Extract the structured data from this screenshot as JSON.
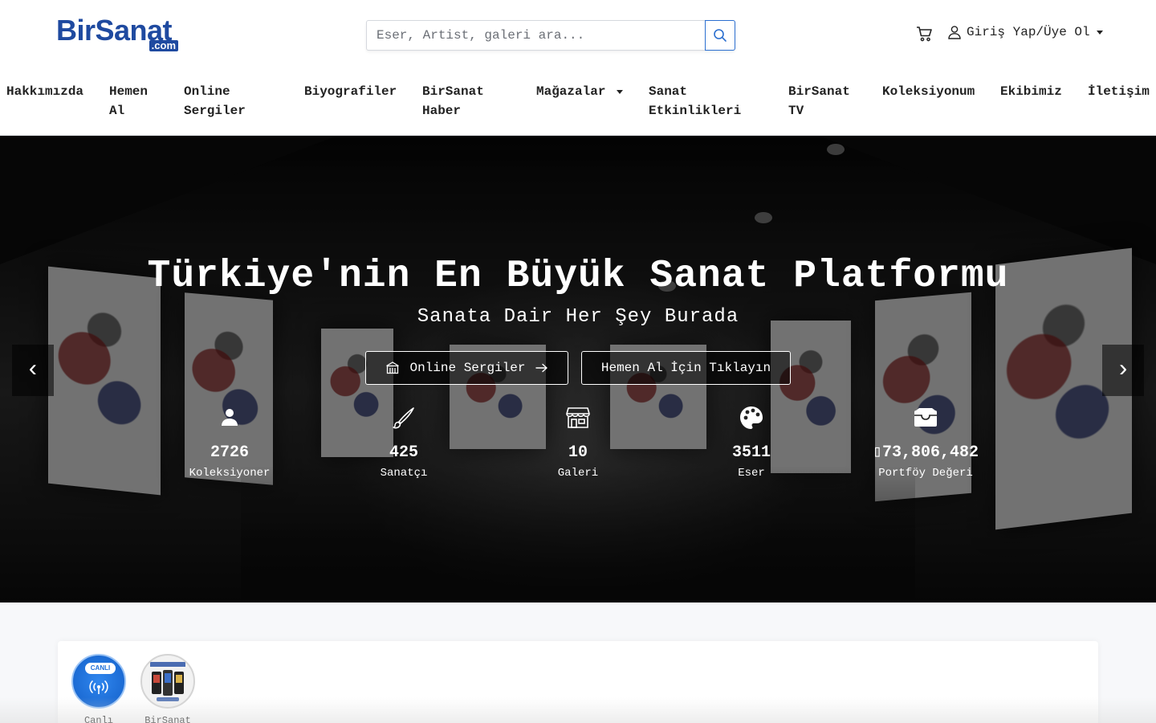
{
  "header": {
    "logo_brand": "BirSanat",
    "logo_tld": ".com",
    "search_placeholder": "Eser, Artist, galeri ara...",
    "login_label": "Giriş Yap/Üye Ol"
  },
  "nav": {
    "items": [
      {
        "label_1": "Hakkımızda",
        "label_2": ""
      },
      {
        "label_1": "Hemen",
        "label_2": "Al"
      },
      {
        "label_1": "Online",
        "label_2": "Sergiler"
      },
      {
        "label_1": "Biyografiler",
        "label_2": ""
      },
      {
        "label_1": "BirSanat",
        "label_2": "Haber"
      },
      {
        "label_1": "Mağazalar",
        "label_2": ""
      },
      {
        "label_1": "Sanat",
        "label_2": "Etkinlikleri"
      },
      {
        "label_1": "BirSanat",
        "label_2": "TV"
      },
      {
        "label_1": "Koleksiyonum",
        "label_2": ""
      },
      {
        "label_1": "Ekibimiz",
        "label_2": ""
      },
      {
        "label_1": "İletişim",
        "label_2": ""
      }
    ]
  },
  "hero": {
    "title": "Türkiye'nin En Büyük Sanat Platformu",
    "subtitle": "Sanata Dair Her Şey Burada",
    "btn_exhibitions": "Online Sergiler",
    "btn_buy": "Hemen Al İçin Tıklayın",
    "prev_glyph": "‹",
    "next_glyph": "›"
  },
  "stats": [
    {
      "icon": "user-icon",
      "value": "2726",
      "label": "Koleksiyoner"
    },
    {
      "icon": "brush-icon",
      "value": "425",
      "label": "Sanatçı"
    },
    {
      "icon": "store-icon",
      "value": "10",
      "label": "Galeri"
    },
    {
      "icon": "palette-icon",
      "value": "3511",
      "label": "Eser"
    },
    {
      "icon": "wallet-icon",
      "value": "73,806,482",
      "label": "Portföy Değeri",
      "currency_glyph": "▯"
    }
  ],
  "stories": [
    {
      "badge": "CANLI",
      "caption": "Canlı"
    },
    {
      "caption": "BirSanat"
    }
  ],
  "colors": {
    "brand": "#1f4aa0",
    "accent": "#2b6fd0",
    "live": "#1e6fd9"
  }
}
